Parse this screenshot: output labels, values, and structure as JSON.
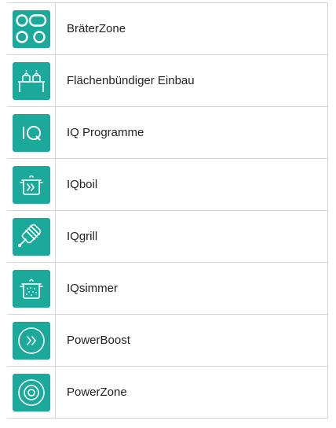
{
  "colors": {
    "accent": "#1aa99a",
    "icon_stroke": "#ffffff",
    "border": "#d6d6d6",
    "text": "#222222"
  },
  "features": [
    {
      "label": "BräterZone",
      "icon": "braeterzone-icon"
    },
    {
      "label": "Flächenbündiger Einbau",
      "icon": "flush-installation-icon"
    },
    {
      "label": "IQ Programme",
      "icon": "iq-programme-icon"
    },
    {
      "label": "IQboil",
      "icon": "iqboil-icon"
    },
    {
      "label": "IQgrill",
      "icon": "iqgrill-icon"
    },
    {
      "label": "IQsimmer",
      "icon": "iqsimmer-icon"
    },
    {
      "label": "PowerBoost",
      "icon": "powerboost-icon"
    },
    {
      "label": "PowerZone",
      "icon": "powerzone-icon"
    }
  ]
}
